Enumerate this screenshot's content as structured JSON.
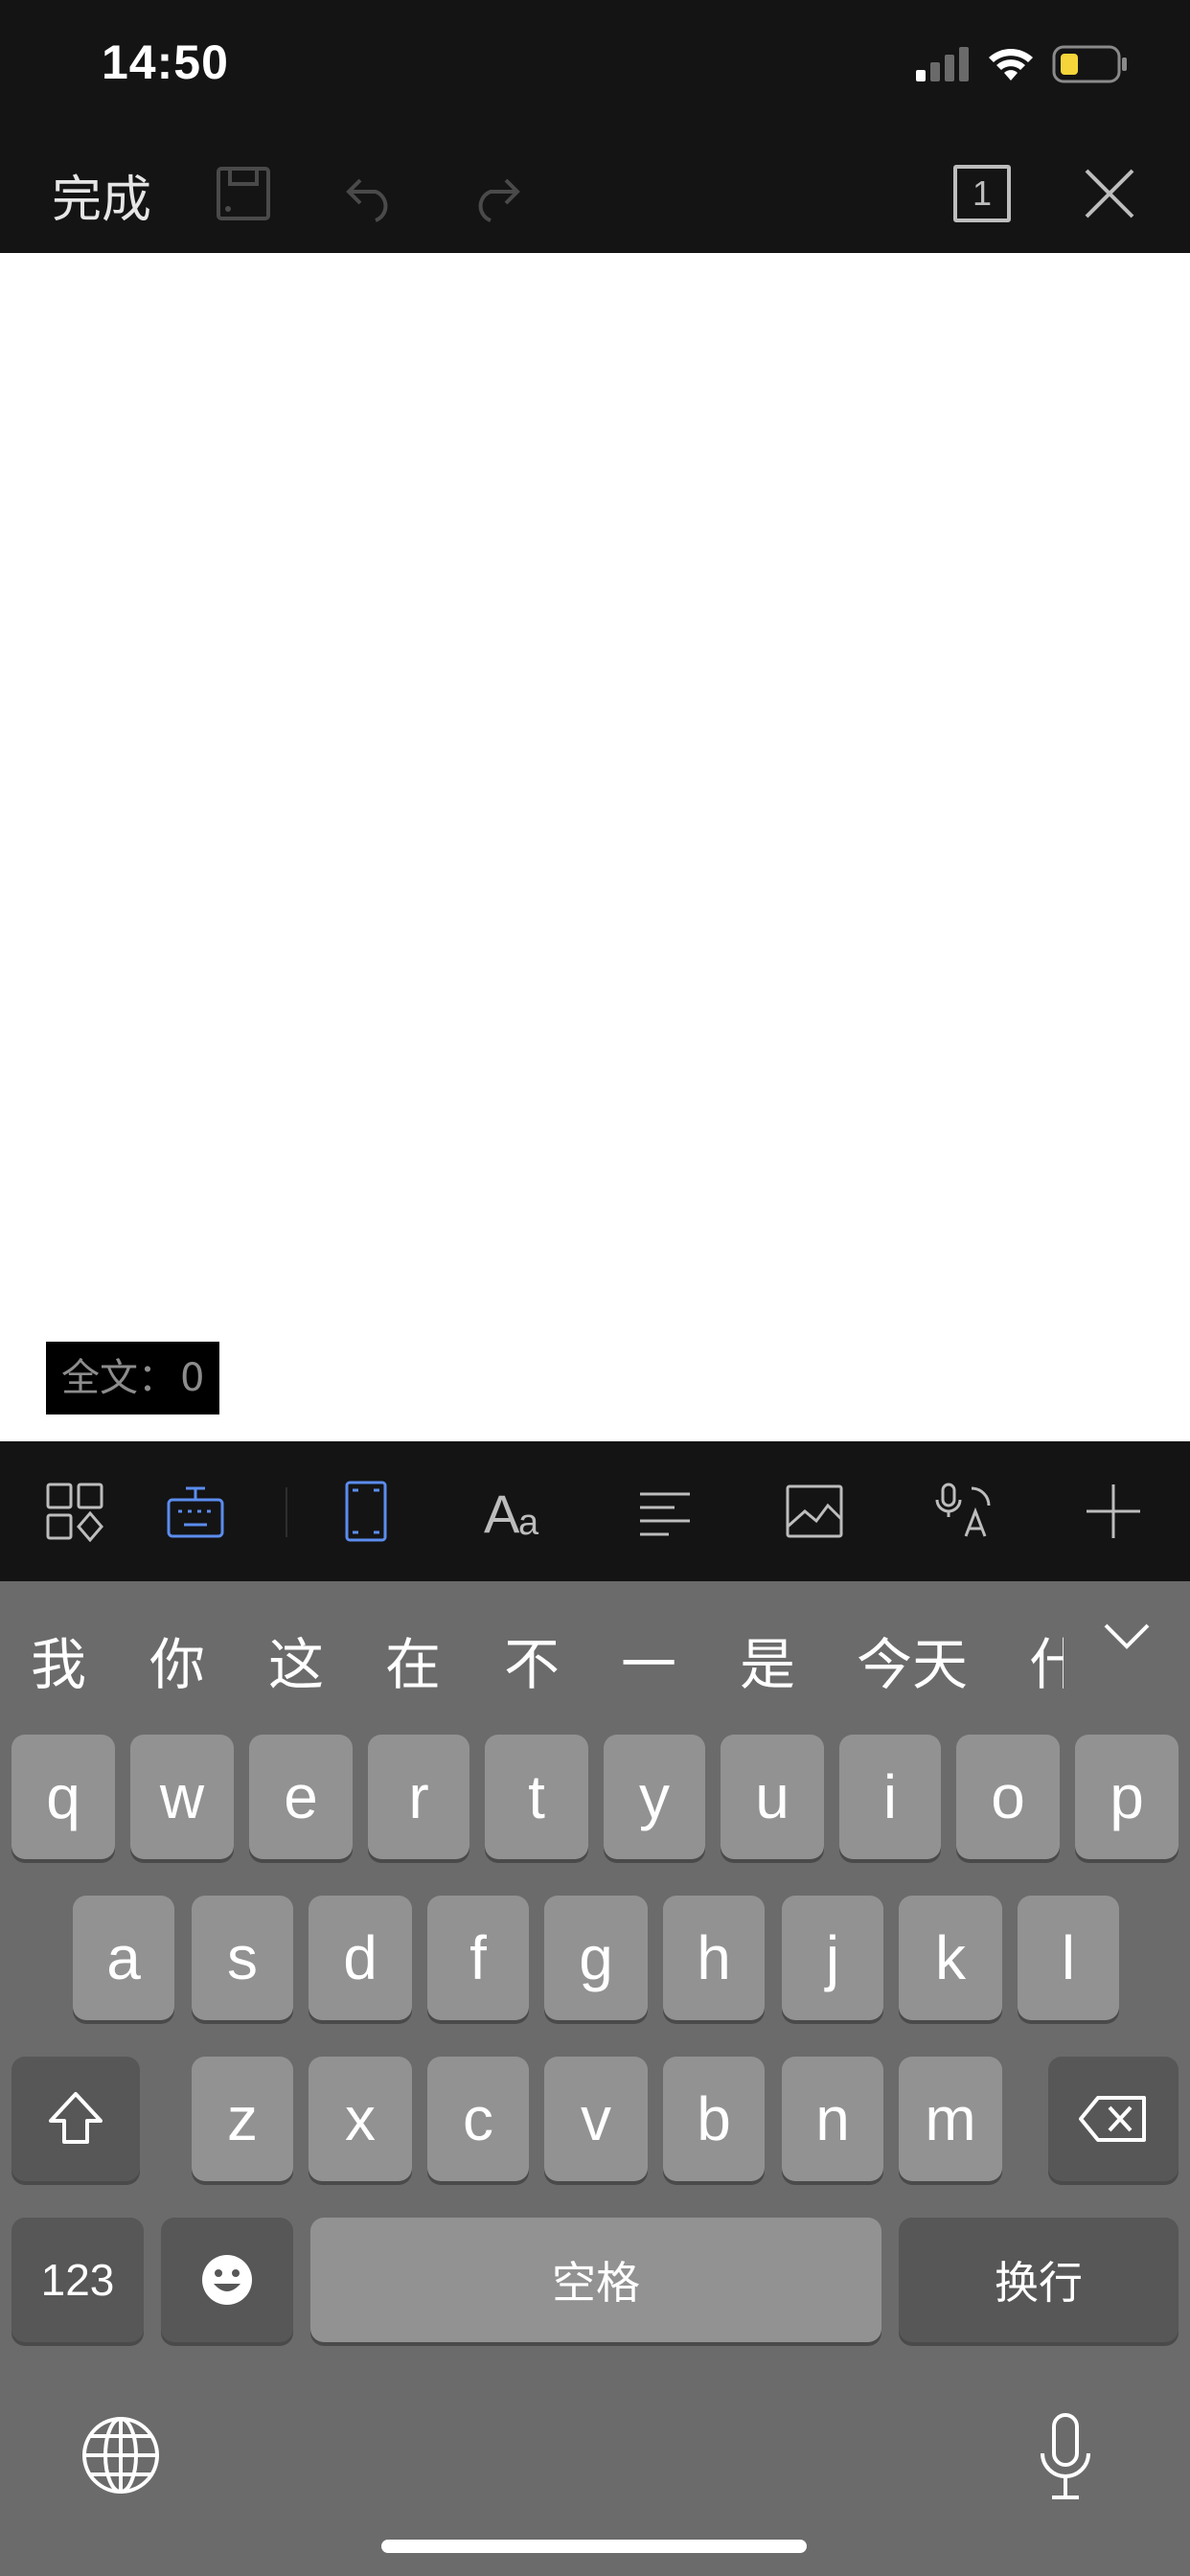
{
  "status_bar": {
    "time": "14:50"
  },
  "toolbar": {
    "done_label": "完成",
    "page_number": "1"
  },
  "document": {
    "word_count_label": "全文：",
    "word_count_value": "0"
  },
  "format_toolbar": {
    "items": [
      "apps-icon",
      "keyboard-icon",
      "page-frame-icon",
      "font-icon",
      "align-icon",
      "image-icon",
      "voice-translate-icon",
      "add-icon"
    ],
    "active_color": "#5b8def"
  },
  "keyboard": {
    "candidates": [
      "我",
      "你",
      "这",
      "在",
      "不",
      "一",
      "是",
      "今天",
      "什"
    ],
    "row1": [
      "q",
      "w",
      "e",
      "r",
      "t",
      "y",
      "u",
      "i",
      "o",
      "p"
    ],
    "row2": [
      "a",
      "s",
      "d",
      "f",
      "g",
      "h",
      "j",
      "k",
      "l"
    ],
    "row3": [
      "z",
      "x",
      "c",
      "v",
      "b",
      "n",
      "m"
    ],
    "numbers_label": "123",
    "space_label": "空格",
    "return_label": "换行"
  }
}
